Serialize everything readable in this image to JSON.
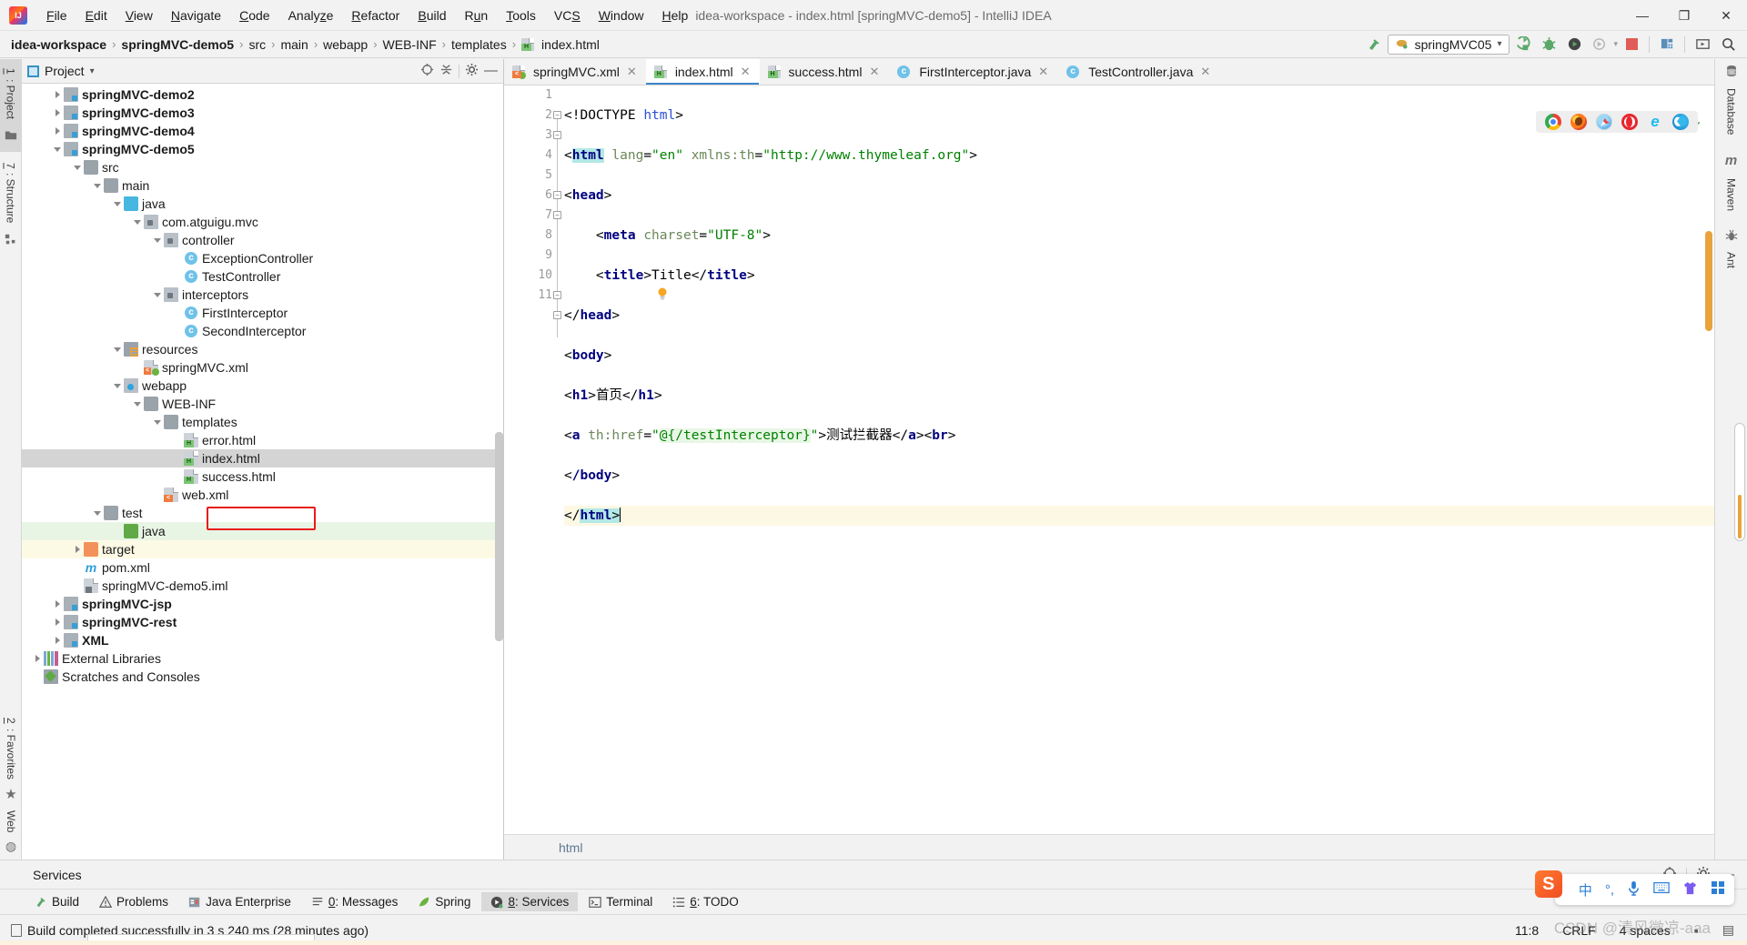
{
  "window": {
    "title": "idea-workspace - index.html [springMVC-demo5] - IntelliJ IDEA",
    "minimize": "—",
    "maximize": "❐",
    "close": "✕"
  },
  "menubar": {
    "items": [
      "File",
      "Edit",
      "View",
      "Navigate",
      "Code",
      "Analyze",
      "Refactor",
      "Build",
      "Run",
      "Tools",
      "VCS",
      "Window",
      "Help"
    ]
  },
  "breadcrumbs": {
    "items": [
      {
        "label": "idea-workspace",
        "bold": true
      },
      {
        "label": "springMVC-demo5",
        "bold": true
      },
      {
        "label": "src",
        "bold": false
      },
      {
        "label": "main",
        "bold": false
      },
      {
        "label": "webapp",
        "bold": false
      },
      {
        "label": "WEB-INF",
        "bold": false
      },
      {
        "label": "templates",
        "bold": false
      },
      {
        "label": "index.html",
        "bold": false
      }
    ],
    "separator": "›"
  },
  "toolbar": {
    "run_config": "springMVC05",
    "run_config_caret": "▾",
    "icons": [
      "build-hammer-icon",
      "run-icon",
      "debug-icon",
      "run-with-coverage-icon",
      "profiler-icon",
      "stop-icon",
      "project-structure-icon",
      "updates-icon",
      "search-everywhere-icon"
    ]
  },
  "left_strip": {
    "items": [
      {
        "label": "1: Project",
        "icon": "project-icon",
        "active": true
      },
      {
        "label": "7: Structure",
        "icon": "structure-icon",
        "active": false
      },
      {
        "label": "2: Favorites",
        "icon": "star-icon",
        "active": false
      },
      {
        "label": "Web",
        "icon": "web-icon",
        "active": false
      }
    ]
  },
  "right_strip": {
    "items": [
      {
        "label": "Database",
        "icon": "database-icon"
      },
      {
        "label": "Maven",
        "icon": "maven-icon"
      },
      {
        "label": "Ant",
        "icon": "ant-icon"
      }
    ]
  },
  "project_panel": {
    "title": "Project",
    "caret": "▾",
    "header_icons": [
      "locate-icon",
      "collapse-all-icon",
      "settings-gear-icon",
      "hide-icon"
    ],
    "tree": [
      {
        "label": "springMVC-demo2",
        "indent": 1,
        "arrow": "right",
        "icon": "module",
        "bold": true,
        "state": "none"
      },
      {
        "label": "springMVC-demo3",
        "indent": 1,
        "arrow": "right",
        "icon": "module",
        "bold": true,
        "state": "none"
      },
      {
        "label": "springMVC-demo4",
        "indent": 1,
        "arrow": "right",
        "icon": "module",
        "bold": true,
        "state": "none"
      },
      {
        "label": "springMVC-demo5",
        "indent": 1,
        "arrow": "down",
        "icon": "module",
        "bold": true,
        "state": "none"
      },
      {
        "label": "src",
        "indent": 2,
        "arrow": "down",
        "icon": "folder",
        "bold": false,
        "state": "none"
      },
      {
        "label": "main",
        "indent": 3,
        "arrow": "down",
        "icon": "folder",
        "bold": false,
        "state": "none"
      },
      {
        "label": "java",
        "indent": 4,
        "arrow": "down",
        "icon": "folder-src",
        "bold": false,
        "state": "none"
      },
      {
        "label": "com.atguigu.mvc",
        "indent": 5,
        "arrow": "down",
        "icon": "package",
        "bold": false,
        "state": "none"
      },
      {
        "label": "controller",
        "indent": 6,
        "arrow": "down",
        "icon": "package",
        "bold": false,
        "state": "none"
      },
      {
        "label": "ExceptionController",
        "indent": 7,
        "arrow": "none",
        "icon": "class",
        "bold": false,
        "state": "none"
      },
      {
        "label": "TestController",
        "indent": 7,
        "arrow": "none",
        "icon": "class",
        "bold": false,
        "state": "none"
      },
      {
        "label": "interceptors",
        "indent": 6,
        "arrow": "down",
        "icon": "package",
        "bold": false,
        "state": "none"
      },
      {
        "label": "FirstInterceptor",
        "indent": 7,
        "arrow": "none",
        "icon": "class",
        "bold": false,
        "state": "none"
      },
      {
        "label": "SecondInterceptor",
        "indent": 7,
        "arrow": "none",
        "icon": "class",
        "bold": false,
        "state": "none"
      },
      {
        "label": "resources",
        "indent": 4,
        "arrow": "down",
        "icon": "resources",
        "bold": false,
        "state": "none"
      },
      {
        "label": "springMVC.xml",
        "indent": 5,
        "arrow": "none",
        "icon": "xml-spring",
        "bold": false,
        "state": "none"
      },
      {
        "label": "webapp",
        "indent": 4,
        "arrow": "down",
        "icon": "webapp",
        "bold": false,
        "state": "none"
      },
      {
        "label": "WEB-INF",
        "indent": 5,
        "arrow": "down",
        "icon": "folder",
        "bold": false,
        "state": "none"
      },
      {
        "label": "templates",
        "indent": 6,
        "arrow": "down",
        "icon": "folder",
        "bold": false,
        "state": "none"
      },
      {
        "label": "error.html",
        "indent": 7,
        "arrow": "none",
        "icon": "html",
        "bold": false,
        "state": "none"
      },
      {
        "label": "index.html",
        "indent": 7,
        "arrow": "none",
        "icon": "html",
        "bold": false,
        "state": "selected"
      },
      {
        "label": "success.html",
        "indent": 7,
        "arrow": "none",
        "icon": "html",
        "bold": false,
        "state": "none"
      },
      {
        "label": "web.xml",
        "indent": 6,
        "arrow": "none",
        "icon": "xml",
        "bold": false,
        "state": "none"
      },
      {
        "label": "test",
        "indent": 3,
        "arrow": "down",
        "icon": "folder",
        "bold": false,
        "state": "none"
      },
      {
        "label": "java",
        "indent": 4,
        "arrow": "none",
        "icon": "folder-test",
        "bold": false,
        "state": "green"
      },
      {
        "label": "target",
        "indent": 2,
        "arrow": "right",
        "icon": "folder-target",
        "bold": false,
        "state": "yellow"
      },
      {
        "label": "pom.xml",
        "indent": 2,
        "arrow": "none",
        "icon": "maven",
        "bold": false,
        "state": "none"
      },
      {
        "label": "springMVC-demo5.iml",
        "indent": 2,
        "arrow": "none",
        "icon": "iml",
        "bold": false,
        "state": "none"
      },
      {
        "label": "springMVC-jsp",
        "indent": 1,
        "arrow": "right",
        "icon": "module",
        "bold": true,
        "state": "none"
      },
      {
        "label": "springMVC-rest",
        "indent": 1,
        "arrow": "right",
        "icon": "module",
        "bold": true,
        "state": "none"
      },
      {
        "label": "XML",
        "indent": 1,
        "arrow": "right",
        "icon": "module",
        "bold": true,
        "state": "none"
      },
      {
        "label": "External Libraries",
        "indent": 0,
        "arrow": "right",
        "icon": "ext-lib",
        "bold": false,
        "state": "none"
      },
      {
        "label": "Scratches and Consoles",
        "indent": 0,
        "arrow": "none",
        "icon": "scratch",
        "bold": false,
        "state": "none"
      }
    ]
  },
  "editor": {
    "tabs": [
      {
        "label": "springMVC.xml",
        "icon": "xml-spring-icon",
        "active": false
      },
      {
        "label": "index.html",
        "icon": "html-icon",
        "active": true
      },
      {
        "label": "success.html",
        "icon": "html-icon",
        "active": false
      },
      {
        "label": "FirstInterceptor.java",
        "icon": "class-icon",
        "active": false
      },
      {
        "label": "TestController.java",
        "icon": "class-icon",
        "active": false
      }
    ],
    "tab_close": "✕",
    "line_numbers": [
      "1",
      "2",
      "3",
      "4",
      "5",
      "6",
      "7",
      "8",
      "9",
      "10",
      "11"
    ],
    "lines": [
      "<!DOCTYPE html>",
      "<html lang=\"en\" xmlns:th=\"http://www.thymeleaf.org\">",
      "<head>",
      "    <meta charset=\"UTF-8\">",
      "    <title>Title</title>",
      "</head>",
      "<body>",
      "<h1>首页</h1>",
      "<a th:href=\"@{/testInterceptor}\">测试拦截器</a><br>",
      "</body>",
      "</html>"
    ],
    "breadcrumb": "html",
    "browser_popup": [
      "chrome-icon",
      "firefox-icon",
      "safari-icon",
      "opera-icon",
      "ie-icon",
      "edge-icon"
    ],
    "inspection_status": "✔"
  },
  "services_panel": {
    "title": "Services",
    "icons": [
      "locate-icon",
      "settings-gear-icon",
      "hide-icon"
    ]
  },
  "tool_windows": [
    {
      "label": "Build",
      "icon": "hammer-icon",
      "active": false
    },
    {
      "label": "Problems",
      "icon": "warning-icon",
      "active": false
    },
    {
      "label": "Java Enterprise",
      "icon": "java-ee-icon",
      "active": false
    },
    {
      "label": "0: Messages",
      "icon": "messages-icon",
      "active": false
    },
    {
      "label": "Spring",
      "icon": "spring-leaf-icon",
      "active": false
    },
    {
      "label": "8: Services",
      "icon": "services-icon",
      "active": true
    },
    {
      "label": "Terminal",
      "icon": "terminal-icon",
      "active": false
    },
    {
      "label": "6: TODO",
      "icon": "todo-icon",
      "active": false
    }
  ],
  "statusbar": {
    "message": "Build completed successfully in 3 s 240 ms (28 minutes ago)",
    "caret_position": "11:8",
    "line_separator": "CRLF",
    "indent": "4 spaces",
    "icons": [
      "lock-icon",
      "event-log-icon"
    ]
  },
  "ime": {
    "logo": "S",
    "items": [
      "中",
      "°,",
      "🎤",
      "⌨",
      "👕",
      "▦"
    ]
  },
  "watermark": "CSDN @清风微凉-aaa"
}
